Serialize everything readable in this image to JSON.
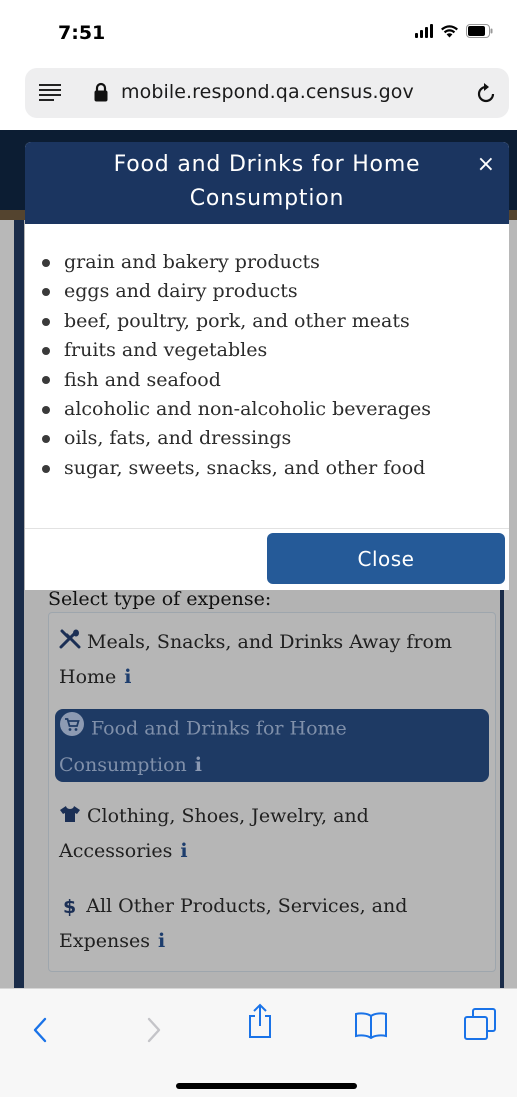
{
  "status_bar": {
    "time": "7:51"
  },
  "browser": {
    "url": "mobile.respond.qa.census.gov"
  },
  "form": {
    "select_label": "Select type of expense:",
    "options": [
      {
        "label_line1": "Meals, Snacks, and Drinks Away from",
        "label_line2": "Home",
        "info": "i",
        "icon": "fork-knife-icon",
        "selected": false
      },
      {
        "label_line1": "Food and Drinks for Home",
        "label_line2": "Consumption",
        "info": "i",
        "icon": "shopping-cart-icon",
        "selected": true
      },
      {
        "label_line1": "Clothing, Shoes, Jewelry, and",
        "label_line2": "Accessories",
        "info": "i",
        "icon": "tshirt-icon",
        "selected": false
      },
      {
        "label_line1": "All Other Products, Services, and",
        "label_line2": "Expenses",
        "info": "i",
        "icon": "dollar-icon",
        "selected": false
      }
    ]
  },
  "modal": {
    "title": "Food and Drinks for Home Consumption",
    "close_symbol": "×",
    "items": [
      "grain and bakery products",
      "eggs and dairy products",
      "beef, poultry, pork, and other meats",
      "fruits and vegetables",
      "fish and seafood",
      "alcoholic and non-alcoholic beverages",
      "oils, fats, and dressings",
      "sugar, sweets, snacks, and other food"
    ],
    "close_button": "Close"
  },
  "toolbar": {
    "icons": [
      "back-icon",
      "forward-icon",
      "share-icon",
      "bookmarks-icon",
      "tabs-icon"
    ]
  },
  "colors": {
    "modal_header": "#1b3560",
    "close_button": "#255a98",
    "selected_option": "#1e3a64",
    "ios_blue": "#1a73e8"
  }
}
